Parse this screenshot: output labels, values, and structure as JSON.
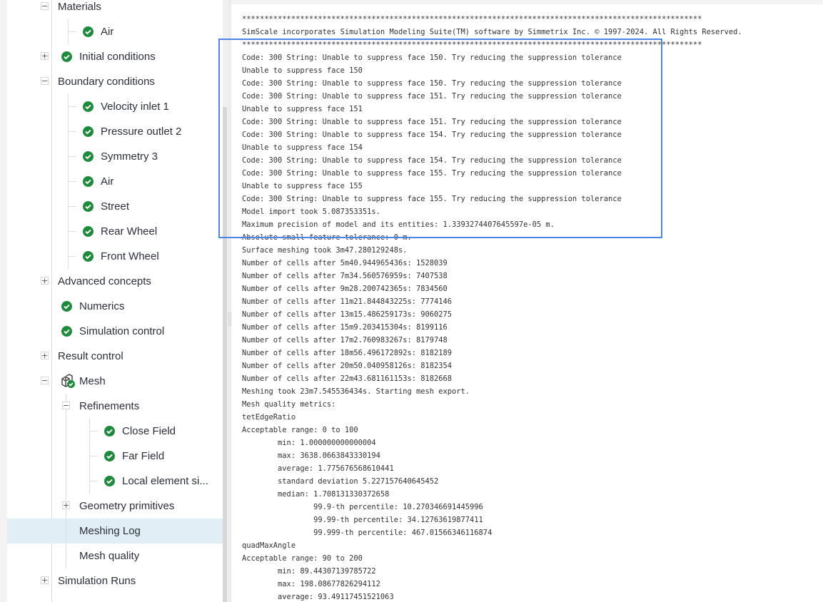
{
  "tree": [
    {
      "label": "Materials",
      "level": 0,
      "exp": "minus"
    },
    {
      "label": "Air",
      "level": 1,
      "check": true
    },
    {
      "label": "Initial conditions",
      "level": 0,
      "exp": "plus",
      "check": true
    },
    {
      "label": "Boundary conditions",
      "level": 0,
      "exp": "minus"
    },
    {
      "label": "Velocity inlet 1",
      "level": 1,
      "check": true
    },
    {
      "label": "Pressure outlet 2",
      "level": 1,
      "check": true
    },
    {
      "label": "Symmetry 3",
      "level": 1,
      "check": true
    },
    {
      "label": "Air",
      "level": 1,
      "check": true
    },
    {
      "label": "Street",
      "level": 1,
      "check": true
    },
    {
      "label": "Rear Wheel",
      "level": 1,
      "check": true
    },
    {
      "label": "Front Wheel",
      "level": 1,
      "check": true
    },
    {
      "label": "Advanced concepts",
      "level": 0,
      "exp": "plus"
    },
    {
      "label": "Numerics",
      "level": 0,
      "check": true
    },
    {
      "label": "Simulation control",
      "level": 0,
      "check": true
    },
    {
      "label": "Result control",
      "level": 0,
      "exp": "plus"
    },
    {
      "label": "Mesh",
      "level": 0,
      "exp": "minus",
      "mesh": true
    },
    {
      "label": "Refinements",
      "level": "1e",
      "exp": "minus"
    },
    {
      "label": "Close Field",
      "level": 2,
      "check": true
    },
    {
      "label": "Far Field",
      "level": 2,
      "check": true
    },
    {
      "label": "Local element si...",
      "level": 2,
      "check": true
    },
    {
      "label": "Geometry primitives",
      "level": "1e",
      "exp": "plus"
    },
    {
      "label": "Meshing Log",
      "level": "1e",
      "selected": true
    },
    {
      "label": "Mesh quality",
      "level": "1e"
    },
    {
      "label": "Simulation Runs",
      "level": 0,
      "exp": "plus"
    }
  ],
  "log": [
    "*******************************************************************************************************",
    "SimScale incorporates Simulation Modeling Suite(TM) software by Simmetrix Inc. © 1997-2024. All Rights Reserved.",
    "*******************************************************************************************************",
    "Code: 300 String: Unable to suppress face 150. Try reducing the suppression tolerance",
    "Unable to suppress face 150",
    "Code: 300 String: Unable to suppress face 150. Try reducing the suppression tolerance",
    "Code: 300 String: Unable to suppress face 151. Try reducing the suppression tolerance",
    "Unable to suppress face 151",
    "Code: 300 String: Unable to suppress face 151. Try reducing the suppression tolerance",
    "Code: 300 String: Unable to suppress face 154. Try reducing the suppression tolerance",
    "Unable to suppress face 154",
    "Code: 300 String: Unable to suppress face 154. Try reducing the suppression tolerance",
    "Code: 300 String: Unable to suppress face 155. Try reducing the suppression tolerance",
    "Unable to suppress face 155",
    "Code: 300 String: Unable to suppress face 155. Try reducing the suppression tolerance",
    "Model import took 5.087353351s.",
    "Maximum precision of model and its entities: 1.3393274407645597e-05 m.",
    "Absolute small feature tolerance: 0 m.",
    "Surface meshing took 3m47.280129248s.",
    "Number of cells after 5m40.944965436s: 1528039",
    "Number of cells after 7m34.560576959s: 7407538",
    "Number of cells after 9m28.200742365s: 7834560",
    "Number of cells after 11m21.844843225s: 7774146",
    "Number of cells after 13m15.486259173s: 9060275",
    "Number of cells after 15m9.203415304s: 8199116",
    "Number of cells after 17m2.760983267s: 8179748",
    "Number of cells after 18m56.496172892s: 8182189",
    "Number of cells after 20m50.040958126s: 8182354",
    "Number of cells after 22m43.681161153s: 8182668",
    "Meshing took 23m7.545536434s. Starting mesh export.",
    "Mesh quality metrics:",
    "tetEdgeRatio",
    "Acceptable range: 0 to 100",
    "        min: 1.000000000000004",
    "        max: 3638.0663843330194",
    "        average: 1.775676568610441",
    "        standard deviation 5.227157640645452",
    "        median: 1.708131330372658",
    "                99.9-th percentile: 10.270346691445996",
    "                99.99-th percentile: 34.12763619877411",
    "                99.999-th percentile: 467.01566346116874",
    "quadMaxAngle",
    "Acceptable range: 90 to 200",
    "        min: 89.44307139785722",
    "        max: 198.08677826294112",
    "        average: 93.49117451521063"
  ],
  "colors": {
    "check": "#1e8a3c",
    "highlight": "#4a86e8",
    "selected": "#e1eef5"
  }
}
